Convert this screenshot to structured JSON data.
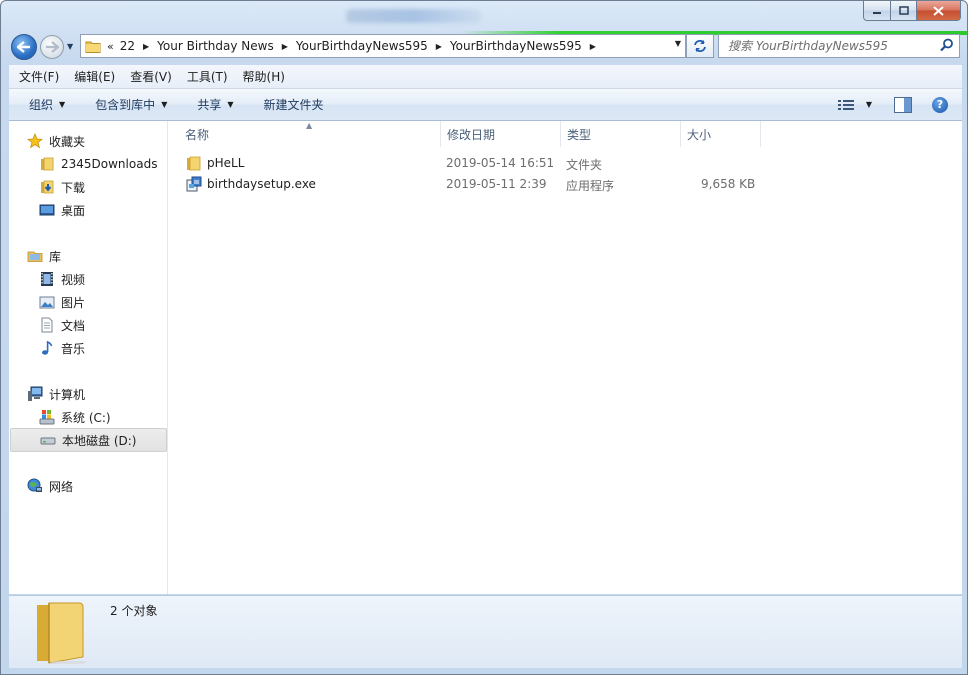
{
  "titlebar": {
    "minimize_icon": "minimize-icon",
    "maximize_icon": "maximize-icon",
    "close_icon": "close-icon"
  },
  "address": {
    "overflow_chevron": "«",
    "crumbs": [
      "22",
      "Your Birthday News",
      "YourBirthdayNews595",
      "YourBirthdayNews595"
    ]
  },
  "search": {
    "placeholder": "搜索 YourBirthdayNews595"
  },
  "menu": [
    "文件(F)",
    "编辑(E)",
    "查看(V)",
    "工具(T)",
    "帮助(H)"
  ],
  "toolbar": {
    "organize": "组织",
    "include_library": "包含到库中",
    "share": "共享",
    "new_folder": "新建文件夹"
  },
  "nav": {
    "favorites": {
      "label": "收藏夹",
      "items": [
        "2345Downloads",
        "下载",
        "桌面"
      ]
    },
    "libraries": {
      "label": "库",
      "items": [
        "视频",
        "图片",
        "文档",
        "音乐"
      ]
    },
    "computer": {
      "label": "计算机",
      "items": [
        "系统 (C:)",
        "本地磁盘 (D:)"
      ],
      "selected": "本地磁盘 (D:)"
    },
    "network": {
      "label": "网络"
    }
  },
  "columns": {
    "name": "名称",
    "date": "修改日期",
    "type": "类型",
    "size": "大小"
  },
  "files": [
    {
      "name": "pHeLL",
      "date": "2019-05-14 16:51",
      "type": "文件夹",
      "size": "",
      "icon": "folder-icon"
    },
    {
      "name": "birthdaysetup.exe",
      "date": "2019-05-11 2:39",
      "type": "应用程序",
      "size": "9,658 KB",
      "icon": "installer-icon"
    }
  ],
  "details": {
    "count": "2 个对象"
  },
  "colors": {
    "accent": "#2a6fc4",
    "window_frame": "#c7d9ee",
    "progress_green": "#2ec92e"
  }
}
